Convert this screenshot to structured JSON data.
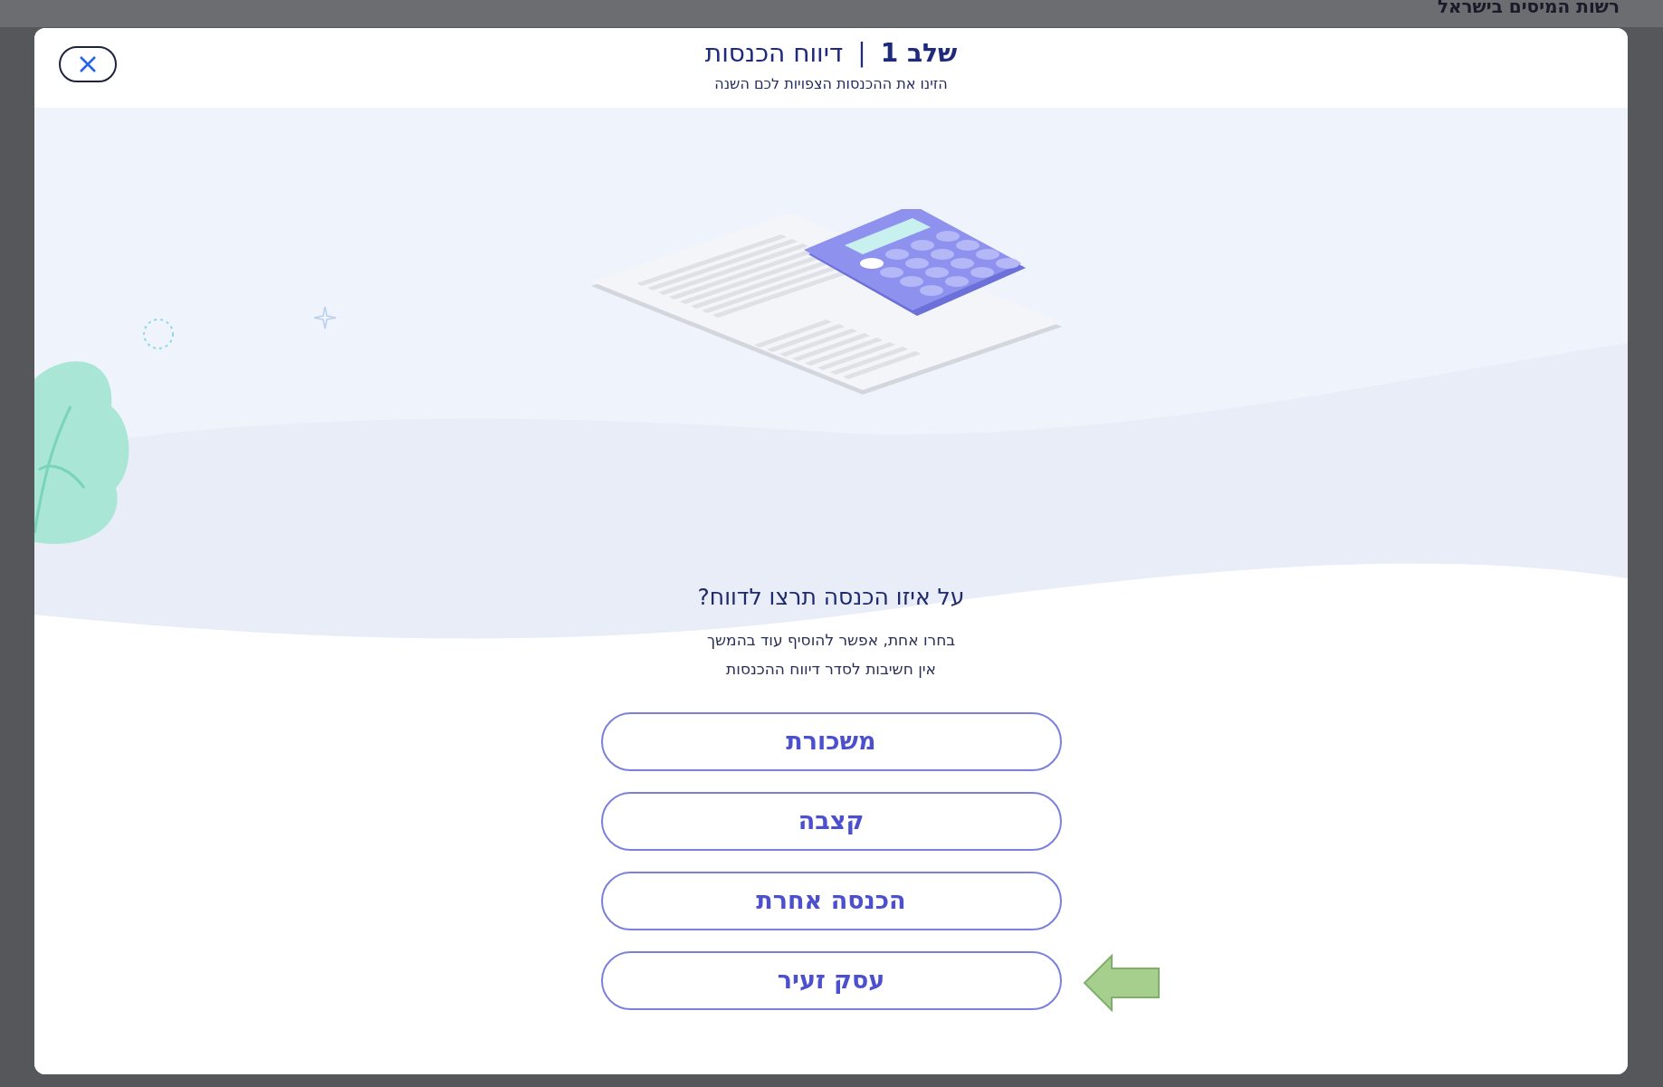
{
  "background_header": {
    "title": "רשות המיסים בישראל"
  },
  "dialog": {
    "step": "שלב 1",
    "separator": "|",
    "title": "דיווח הכנסות",
    "subtitle": "הזינו את ההכנסות הצפויות לכם השנה",
    "question": "על איזו הכנסה תרצו לדווח?",
    "hints": [
      "בחרו אחת, אפשר להוסיף עוד בהמשך",
      "אין חשיבות לסדר דיווח ההכנסות"
    ],
    "options": [
      {
        "label": "משכורת",
        "annotated": false
      },
      {
        "label": "קצבה",
        "annotated": false
      },
      {
        "label": "הכנסה אחרת",
        "annotated": false
      },
      {
        "label": "עסק זעיר",
        "annotated": true
      }
    ]
  }
}
